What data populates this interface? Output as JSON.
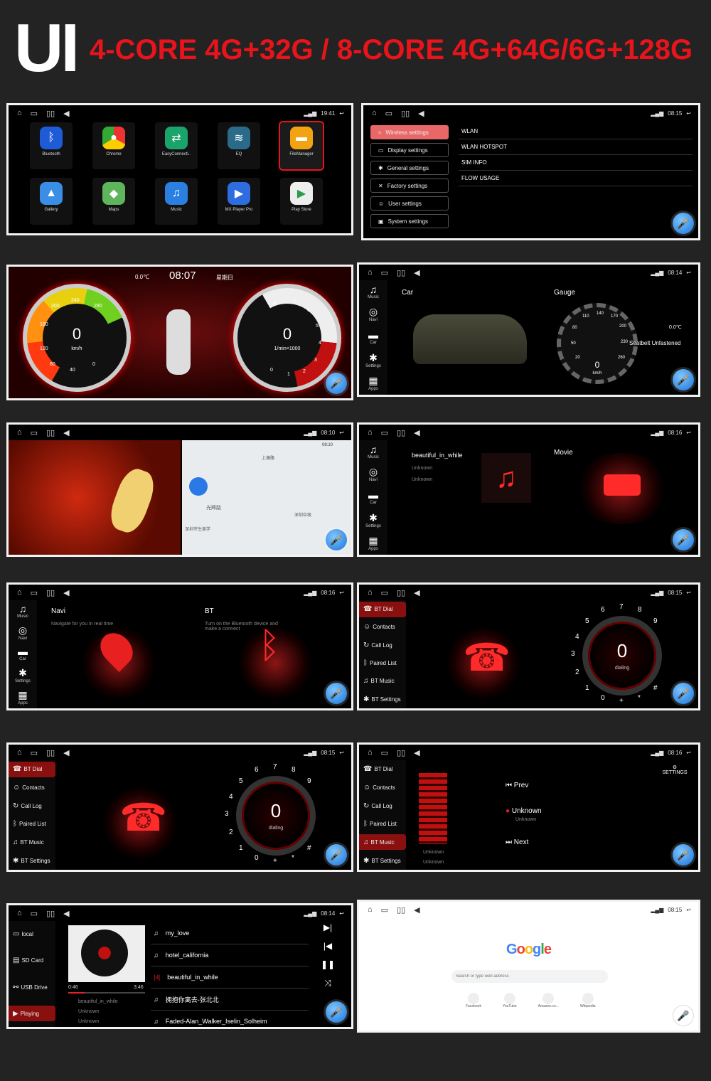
{
  "header": {
    "ui": "UI",
    "spec": "4-CORE 4G+32G / 8-CORE 4G+64G/6G+128G"
  },
  "status_times": {
    "s1": "19:41",
    "s2": "08:15",
    "s4": "08:14",
    "s5": "08:10",
    "s6": "08:16",
    "s7": "08:16",
    "s8": "08:15",
    "s9": "08:15",
    "s10": "08:16",
    "s11": "08:14",
    "s12": "08:15"
  },
  "apps": [
    "Bluetooth",
    "Chrome",
    "EasyConnecti..",
    "EQ",
    "FileManager",
    "Gallery",
    "Maps",
    "Music",
    "MX Player Pro",
    "Play Store"
  ],
  "settings": {
    "menu": [
      "Wireless settings",
      "Display settings",
      "General settings",
      "Factory settings",
      "User settings",
      "System settings"
    ],
    "right": [
      "WLAN",
      "WLAN HOTSPOT",
      "SIM INFO",
      "FLOW USAGE"
    ]
  },
  "cluster": {
    "temp": "0.0℃",
    "time": "08:07",
    "day": "星期日",
    "speed": "0",
    "speed_unit": "km/h",
    "rpm": "0",
    "rpm_unit": "1/min×1000",
    "speed_ticks": [
      "240",
      "280",
      "200",
      "160",
      "120",
      "80",
      "40",
      "0"
    ],
    "rpm_ticks": [
      "8",
      "7",
      "6",
      "5",
      "4",
      "3",
      "2",
      "1",
      "0"
    ]
  },
  "lnav": [
    "Music",
    "Navi",
    "Car",
    "Settings",
    "Apps"
  ],
  "car": {
    "car_label": "Car",
    "gauge_label": "Gauge",
    "speed": "0",
    "unit": "km/h",
    "temp": "0.0℃",
    "seatbelt": "Seatbelt Unfastened",
    "ticks": [
      "110",
      "140",
      "170",
      "200",
      "230",
      "260",
      "80",
      "50",
      "20"
    ]
  },
  "nav_map": {
    "labels": [
      "上塘路",
      "光辉路",
      "深圳市生美学",
      "深圳中级"
    ],
    "time": "08:10"
  },
  "music_movie": {
    "song": "beautiful_in_while",
    "artist": "Unknown",
    "album": "Unknown",
    "movie": "Movie"
  },
  "navi_bt": {
    "navi": "Navi",
    "navi_sub": "Navigate for you in real time",
    "bt": "BT",
    "bt_sub": "Turn on the Bluetooth device and make a connect"
  },
  "bt_menu": [
    "BT Dial",
    "Contacts",
    "Call Log",
    "Paired List",
    "BT Music",
    "BT Settings"
  ],
  "dialer": {
    "num": "0",
    "label": "dialing",
    "keys": [
      "6",
      "7",
      "8",
      "5",
      "9",
      "4",
      "3",
      "2",
      "1",
      "0",
      "+",
      "*",
      "#"
    ]
  },
  "bt_music": {
    "prev": "Prev",
    "track": "Unknown",
    "track_sub": "Unknown",
    "next": "Next",
    "settings": "SETTINGS",
    "artist": "Unknown",
    "album": "Unknown"
  },
  "player": {
    "sources": [
      "local",
      "SD Card",
      "USB Drive",
      "Playing"
    ],
    "time_start": "0:46",
    "time_end": "3:46",
    "now": "beautiful_in_while",
    "artist": "Unknown",
    "album": "Unknown",
    "tracks": [
      "my_love",
      "hotel_california",
      "beautiful_in_while",
      "拥抱你离去-张北北",
      "Faded-Alan_Walker_Iselin_Solheim"
    ]
  },
  "chrome": {
    "search_placeholder": "Search or type web address",
    "tiles": [
      "Facebook",
      "YouTube",
      "Amazon.co...",
      "Wikipedia"
    ]
  }
}
